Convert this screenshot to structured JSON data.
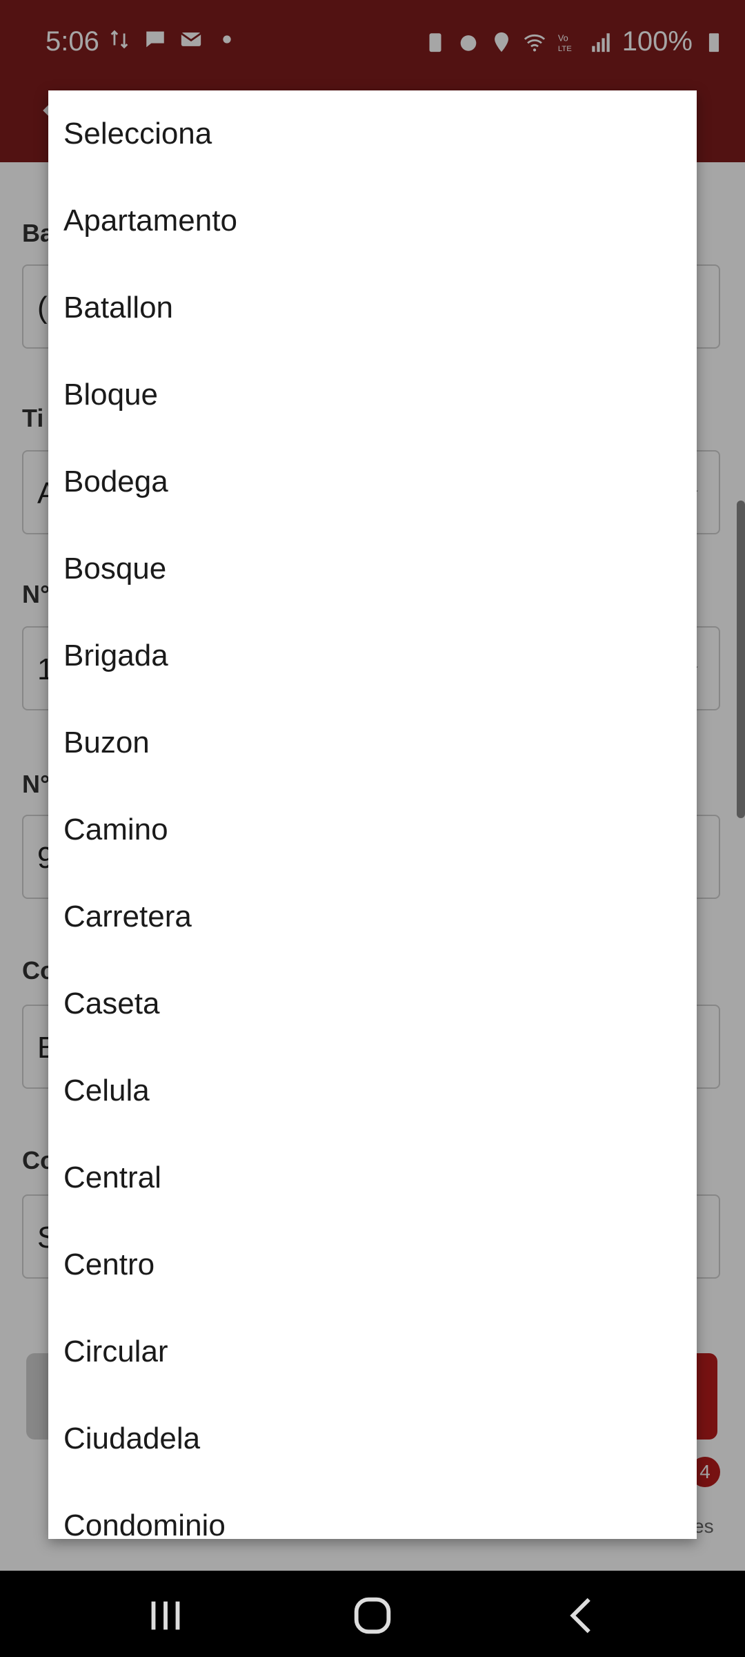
{
  "status_bar": {
    "time": "5:06",
    "battery": "100%"
  },
  "form": {
    "partial_labels": [
      "Ba",
      "Ti",
      "N°",
      "N°",
      "Co",
      "Co"
    ],
    "partial_values": [
      "(",
      "A",
      "1",
      "9",
      "B",
      "S"
    ],
    "badge_count": "4",
    "bottom_text_fragment": "es"
  },
  "dropdown": {
    "options": [
      "Selecciona",
      "Apartamento",
      "Batallon",
      "Bloque",
      "Bodega",
      "Bosque",
      "Brigada",
      "Buzon",
      "Camino",
      "Carretera",
      "Caseta",
      "Celula",
      "Central",
      "Centro",
      "Circular",
      "Ciudadela",
      "Condominio"
    ]
  },
  "colors": {
    "app_bar": "#7f1d1d",
    "accent": "#b71c1c"
  }
}
